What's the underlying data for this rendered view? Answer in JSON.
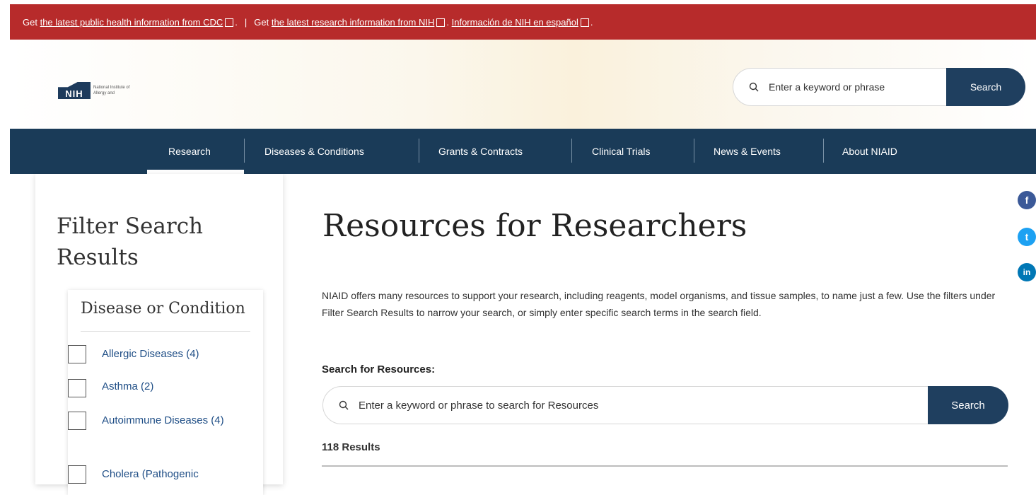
{
  "alert": {
    "prefix1": "Get ",
    "link1": "the latest public health information from CDC",
    "separator": "|",
    "prefix2": "Get ",
    "link2": "the latest research information from NIH",
    "link3": "Información de NIH en español",
    "period": "."
  },
  "header": {
    "logo_mark": "NIH",
    "logo_text": "National Institute of Allergy and",
    "search_placeholder": "Enter a keyword or phrase",
    "search_button": "Search"
  },
  "nav": {
    "items": [
      {
        "label": "Research",
        "active": true
      },
      {
        "label": "Diseases & Conditions"
      },
      {
        "label": "Grants & Contracts"
      },
      {
        "label": "Clinical Trials"
      },
      {
        "label": "News & Events"
      },
      {
        "label": "About NIAID"
      }
    ]
  },
  "sidebar": {
    "title": "Filter Search Results",
    "filter_group": "Disease or Condition",
    "options": [
      {
        "label": "Allergic Diseases (4)"
      },
      {
        "label": "Asthma (2)"
      },
      {
        "label": "Autoimmune Diseases (4)"
      },
      {
        "label": "Cholera (Pathogenic"
      }
    ]
  },
  "main": {
    "title": "Resources for Researchers",
    "intro": "NIAID offers many resources to support your research, including reagents, model organisms, and tissue samples, to name just a few. Use the filters under Filter Search Results to narrow your search, or simply enter specific search terms in the search field.",
    "search_label": "Search for Resources:",
    "search_placeholder": "Enter a keyword or phrase to search for Resources",
    "search_button": "Search",
    "results": "118 Results"
  },
  "social": {
    "facebook": "f",
    "twitter": "t",
    "linkedin": "in",
    "colors": {
      "facebook": "#3b5998",
      "twitter": "#1da1f2",
      "linkedin": "#0077b5"
    }
  },
  "colors": {
    "alert_red": "#b72b2b",
    "nav_navy": "#1a3b58",
    "button_navy": "#1f3f5f",
    "link_blue": "#1f4e86"
  }
}
